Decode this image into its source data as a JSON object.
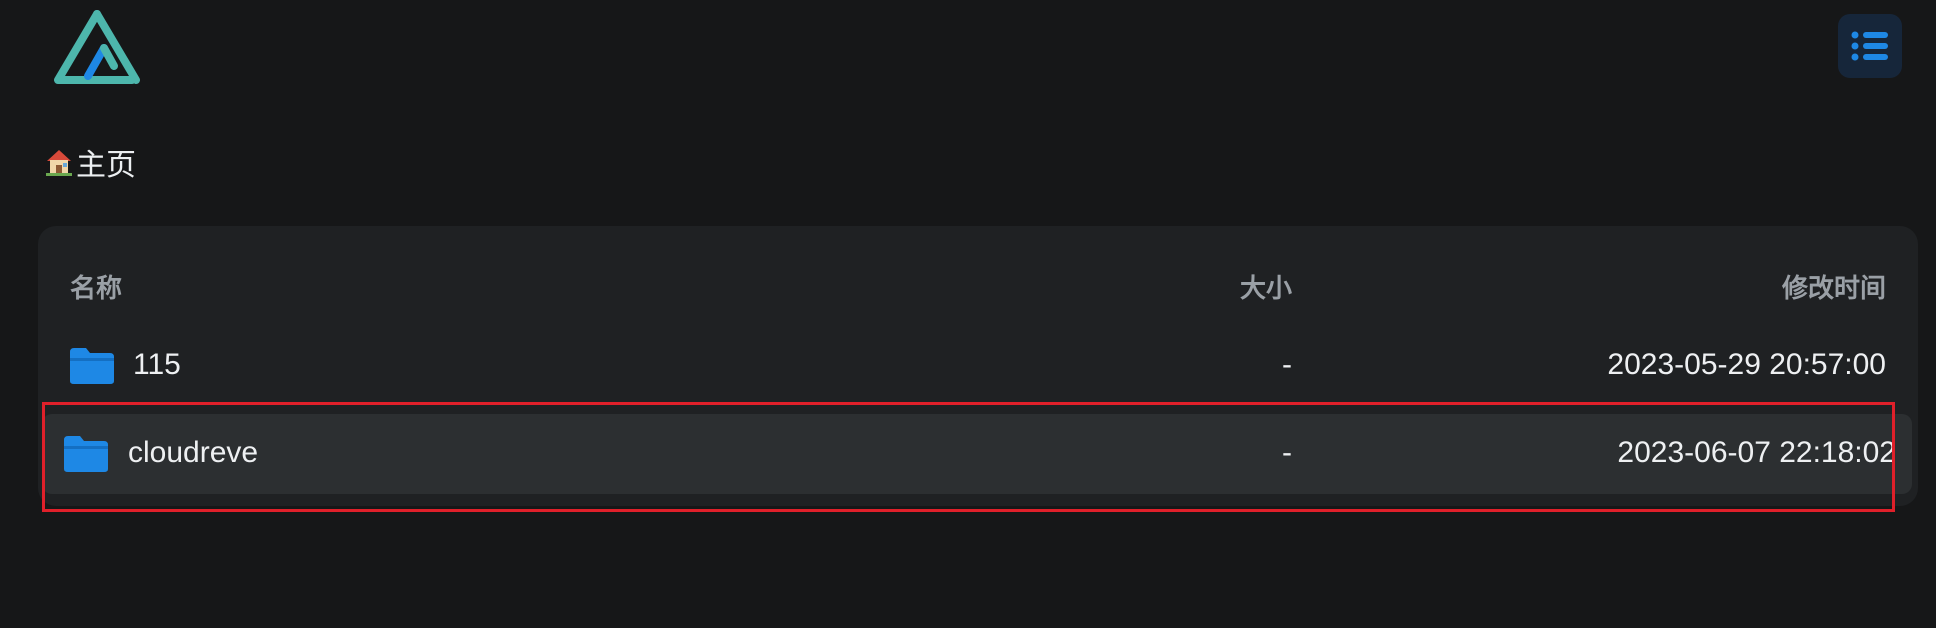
{
  "header": {
    "logo_icon": "alist-logo-icon",
    "menu_icon": "list-menu-icon",
    "accent_color": "#1e88e5"
  },
  "breadcrumb": {
    "icon": "house-icon",
    "label": "主页"
  },
  "table": {
    "columns": {
      "name": "名称",
      "size": "大小",
      "modified": "修改时间"
    },
    "rows": [
      {
        "icon": "folder-icon",
        "name": "115",
        "size": "-",
        "modified": "2023-05-29 20:57:00"
      },
      {
        "icon": "folder-icon",
        "name": "cloudreve",
        "size": "-",
        "modified": "2023-06-07 22:18:02"
      }
    ]
  },
  "highlight_color": "#e0202a"
}
